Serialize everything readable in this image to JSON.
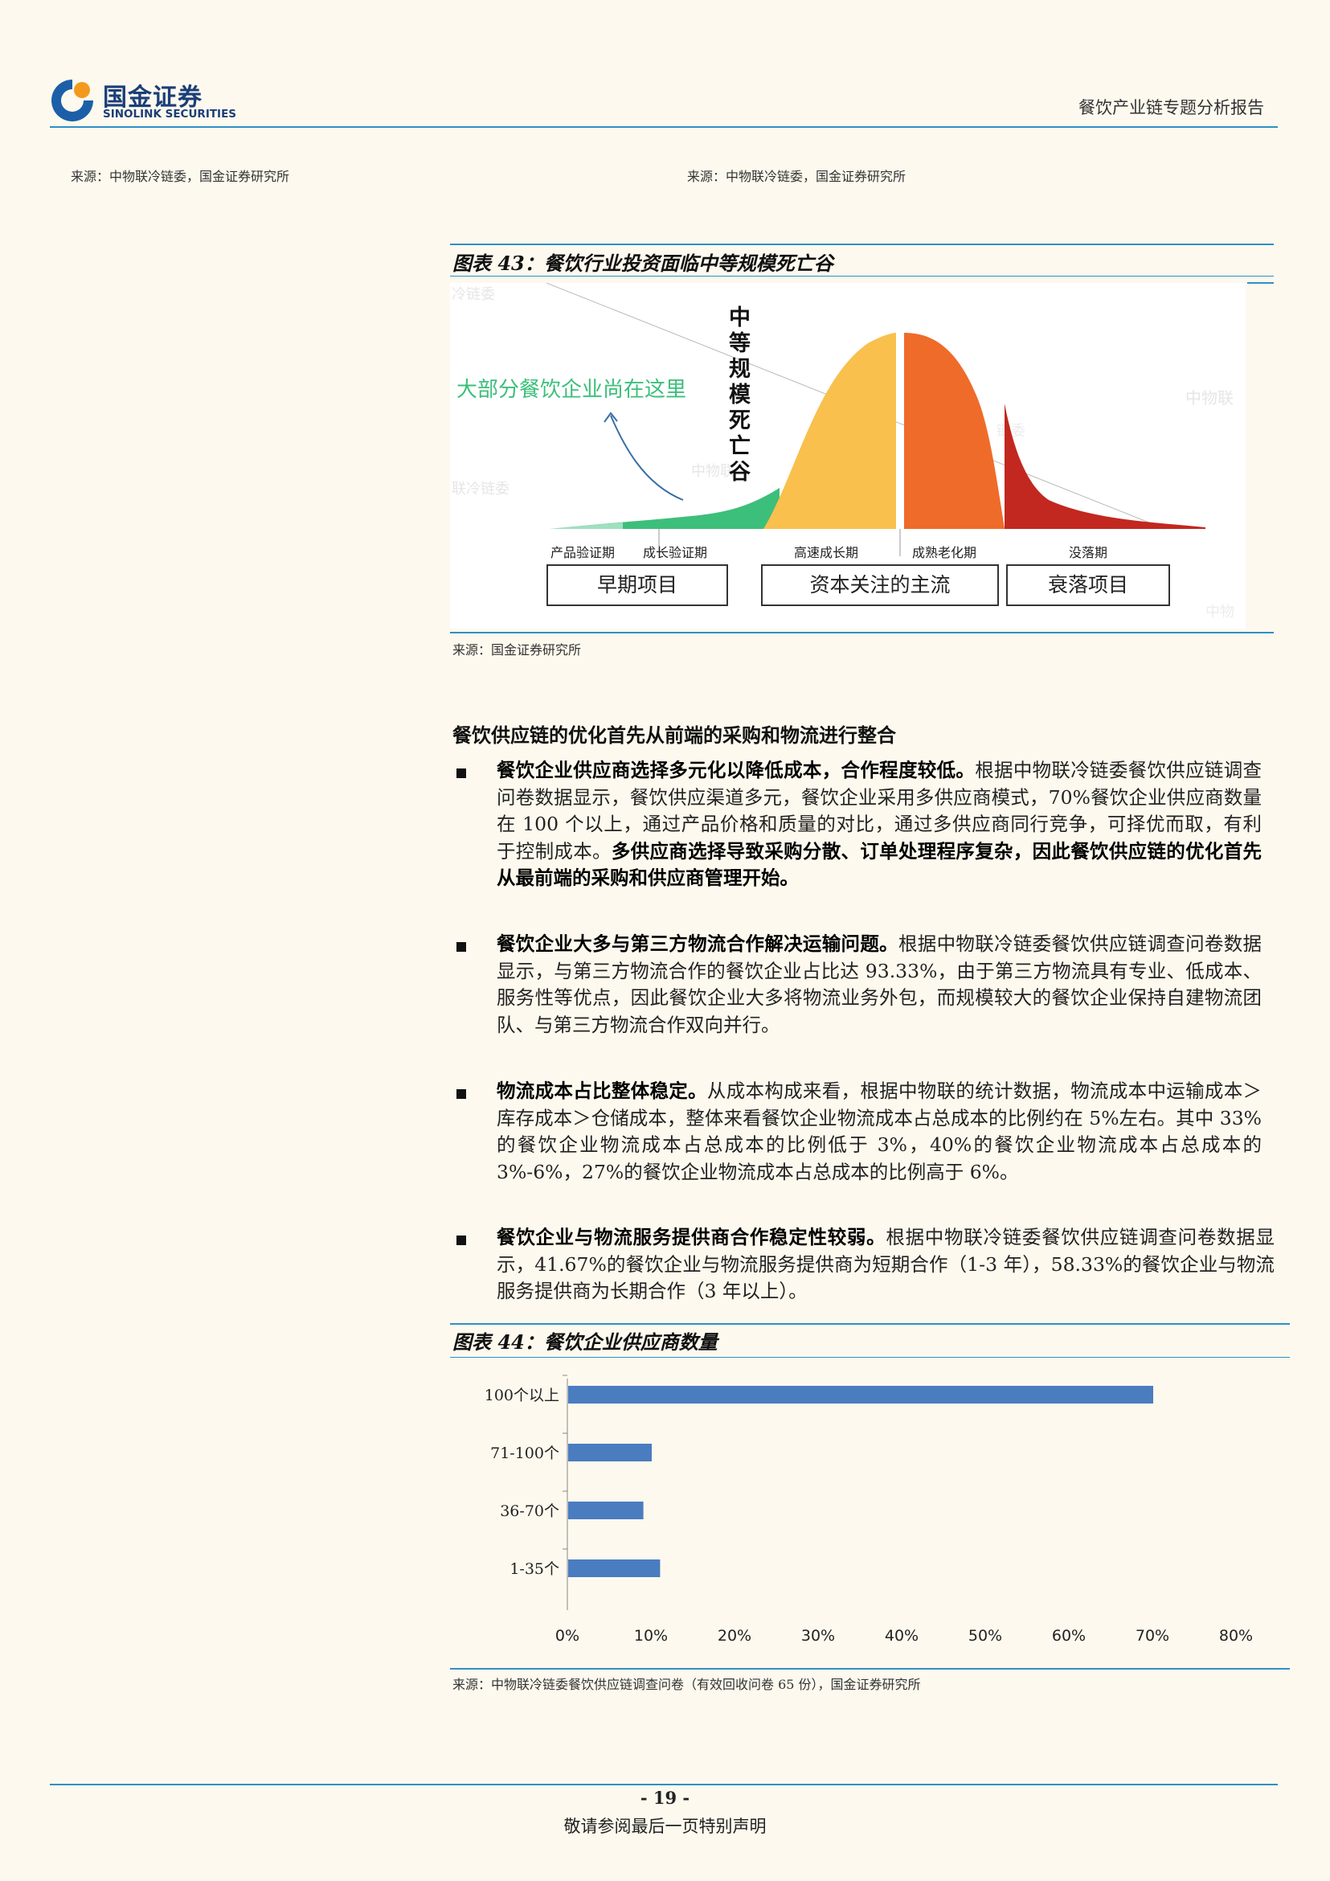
{
  "header": {
    "logo_cn": "国金证券",
    "logo_en": "SINOLINK SECURITIES",
    "report_title": "餐饮产业链专题分析报告"
  },
  "top_sources": {
    "left": "来源：中物联冷链委，国金证券研究所",
    "right": "来源：中物联冷链委，国金证券研究所"
  },
  "figure43": {
    "title": "图表 43：餐饮行业投资面临中等规模死亡谷",
    "annotation": "大部分餐饮企业尚在这里",
    "valley_label": "中等规模死亡谷",
    "stages": [
      "产品验证期",
      "成长验证期",
      "高速成长期",
      "成熟老化期",
      "没落期"
    ],
    "boxes": [
      "早期项目",
      "资本关注的主流",
      "衰落项目"
    ],
    "watermark": "中物联冷链委",
    "source": "来源：国金证券研究所",
    "colors": {
      "early": "#3cbf7a",
      "growth": "#f9c04e",
      "mature": "#ef6b2a",
      "decline": "#c2281f"
    }
  },
  "section_heading": "餐饮供应链的优化首先从前端的采购和物流进行整合",
  "bullets": [
    {
      "lead": "餐饮企业供应商选择多元化以降低成本，合作程度较低。",
      "body": "根据中物联冷链委餐饮供应链调查问卷数据显示，餐饮供应渠道多元，餐饮企业采用多供应商模式，70%餐饮企业供应商数量在 100 个以上，通过产品价格和质量的对比，通过多供应商同行竞争，可择优而取，有利于控制成本。",
      "tail": "多供应商选择导致采购分散、订单处理程序复杂，因此餐饮供应链的优化首先从最前端的采购和供应商管理开始。"
    },
    {
      "lead": "餐饮企业大多与第三方物流合作解决运输问题。",
      "body": "根据中物联冷链委餐饮供应链调查问卷数据显示，与第三方物流合作的餐饮企业占比达 93.33%，由于第三方物流具有专业、低成本、服务性等优点，因此餐饮企业大多将物流业务外包，而规模较大的餐饮企业保持自建物流团队、与第三方物流合作双向并行。",
      "tail": ""
    },
    {
      "lead": "物流成本占比整体稳定。",
      "body": "从成本构成来看，根据中物联的统计数据，物流成本中运输成本＞库存成本＞仓储成本，整体来看餐饮企业物流成本占总成本的比例约在 5%左右。其中 33%的餐饮企业物流成本占总成本的比例低于 3%，40%的餐饮企业物流成本占总成本的 3%-6%，27%的餐饮企业物流成本占总成本的比例高于 6%。",
      "tail": ""
    },
    {
      "lead": "餐饮企业与物流服务提供商合作稳定性较弱。",
      "body": "根据中物联冷链委餐饮供应链调查问卷数据显示，41.67%的餐饮企业与物流服务提供商为短期合作（1-3 年），58.33%的餐饮企业与物流服务提供商为长期合作（3 年以上）。",
      "tail": ""
    }
  ],
  "figure44": {
    "title": "图表 44：餐饮企业供应商数量",
    "source": "来源：中物联冷链委餐饮供应链调查问卷（有效回收问卷 65 份），国金证券研究所"
  },
  "chart_data": {
    "type": "bar",
    "orientation": "horizontal",
    "categories": [
      "100个以上",
      "71-100个",
      "36-70个",
      "1-35个"
    ],
    "values": [
      70,
      10,
      9,
      11
    ],
    "unit": "%",
    "xlim": [
      0,
      80
    ],
    "xticks": [
      "0%",
      "10%",
      "20%",
      "30%",
      "40%",
      "50%",
      "60%",
      "70%",
      "80%"
    ],
    "bar_color": "#4a7cc0",
    "grid": false
  },
  "footer": {
    "page_number": "- 19 -",
    "disclaimer": "敬请参阅最后一页特别声明"
  }
}
